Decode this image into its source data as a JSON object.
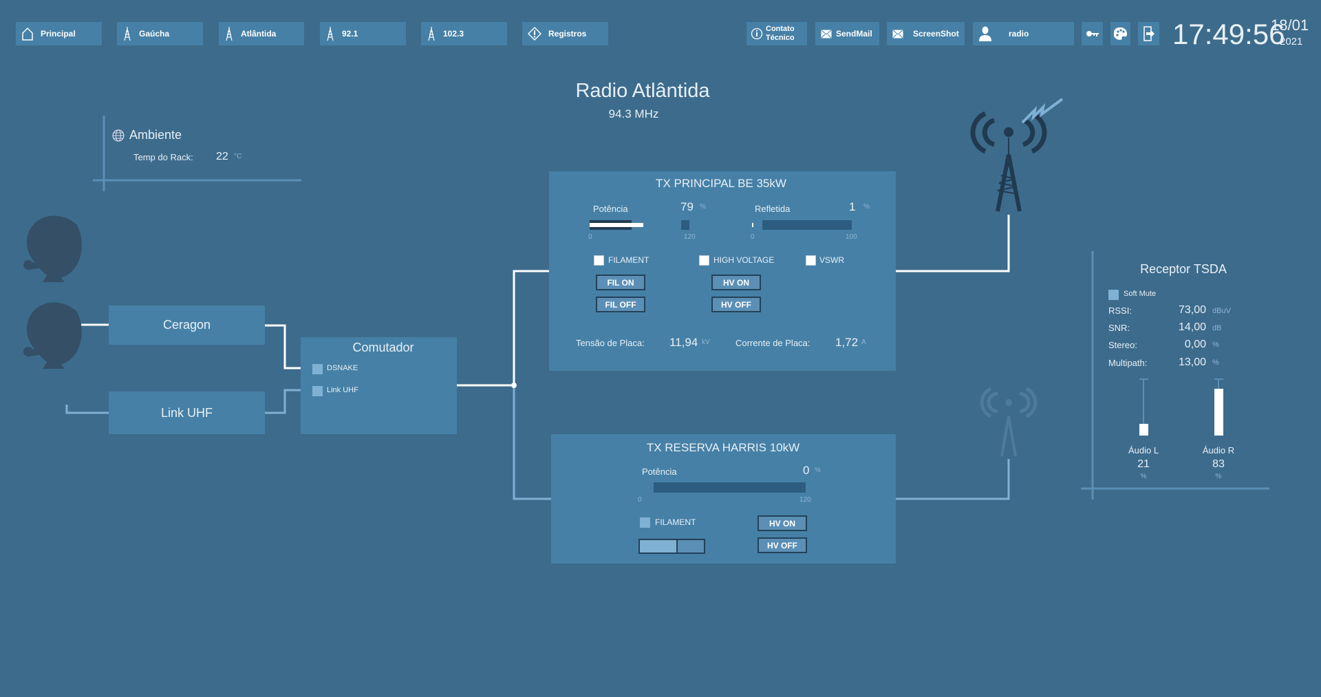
{
  "toolbar": {
    "principal": "Principal",
    "gaucha": "Gaúcha",
    "atlantida": "Atlântida",
    "f921": "92.1",
    "f1023": "102.3",
    "registros": "Registros",
    "contato_1": "Contato",
    "contato_2": "Técnico",
    "sendmail": "SendMail",
    "screenshot": "ScreenShot",
    "user": "radio",
    "time": "17:49:56",
    "date": "18/01",
    "year": "2021"
  },
  "header": {
    "title": "Radio Atlântida",
    "subtitle": "94.3 MHz"
  },
  "ambiente": {
    "title": "Ambiente",
    "temp_label": "Temp  do Rack:",
    "temp_value": "22",
    "temp_unit": "°C"
  },
  "links": {
    "ceragon": "Ceragon",
    "link_uhf": "Link UHF"
  },
  "comutador": {
    "title": "Comutador",
    "input1": "DSNAKE",
    "input2": "Link UHF",
    "input1_active": false,
    "input2_active": false
  },
  "tx_principal": {
    "title": "TX PRINCIPAL BE 35kW",
    "potencia_label": "Potência",
    "potencia_value": "79",
    "potencia_unit": "%",
    "potencia_min": "0",
    "potencia_max": "120",
    "refletida_label": "Refletida",
    "refletida_value": "1",
    "refletida_unit": "%",
    "refletida_min": "0",
    "refletida_max": "100",
    "filament": "FILAMENT",
    "high_voltage": "HIGH VOLTAGE",
    "vswr": "VSWR",
    "fil_on": "FIL ON",
    "fil_off": "FIL OFF",
    "hv_on": "HV ON",
    "hv_off": "HV OFF",
    "tensao_label": "Tensão de Placa:",
    "tensao_value": "11,94",
    "tensao_unit": "kV",
    "corrente_label": "Corrente de Placa:",
    "corrente_value": "1,72",
    "corrente_unit": "A"
  },
  "tx_reserva": {
    "title": "TX RESERVA HARRIS 10kW",
    "potencia_label": "Potência",
    "potencia_value": "0",
    "potencia_unit": "%",
    "potencia_min": "0",
    "potencia_max": "120",
    "filament": "FILAMENT",
    "hv_on": "HV ON",
    "hv_off": "HV OFF"
  },
  "receptor": {
    "title": "Receptor TSDA",
    "soft_mute": "Soft Mute",
    "rows": [
      {
        "label": "RSSI:",
        "value": "73,00",
        "unit": "dBuV"
      },
      {
        "label": "SNR:",
        "value": "14,00",
        "unit": "dB"
      },
      {
        "label": "Stereo:",
        "value": "0,00",
        "unit": "%"
      },
      {
        "label": "Multipath:",
        "value": "13,00",
        "unit": "%"
      }
    ],
    "audio_l_label": "Áudio L",
    "audio_l_value": "21",
    "audio_r_label": "Áudio R",
    "audio_r_value": "83",
    "audio_unit": "%"
  },
  "colors": {
    "background": "#3d6b8c",
    "panel": "#4680a6",
    "active_line": "#ffffff",
    "inactive_line": "#7fb1d4",
    "icon_dark": "#213a50"
  }
}
